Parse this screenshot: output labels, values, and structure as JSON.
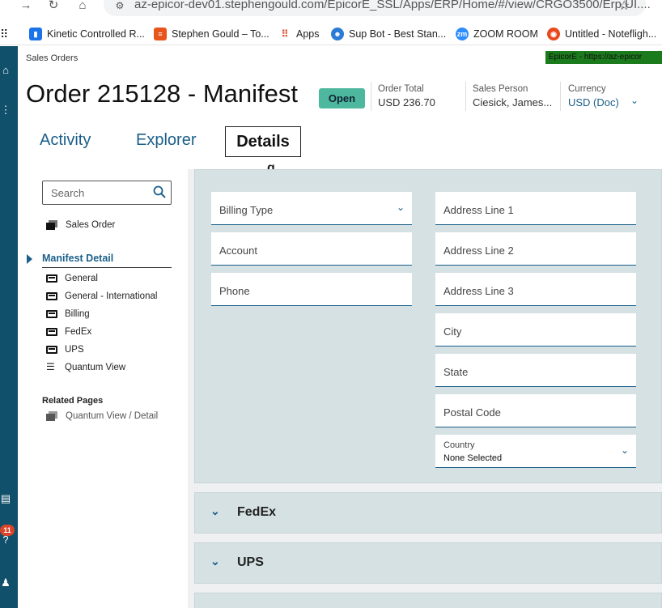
{
  "browser": {
    "url": "az-epicor-dev01.stephengould.com/EpicorE_SSL/Apps/ERP/Home/#/view/CRGO3500/Erp.UI....",
    "bookmarks": [
      {
        "label": "Kinetic Controlled R...",
        "icon": "bookmark-icon",
        "color": "#1a73e8"
      },
      {
        "label": "Stephen Gould – To...",
        "icon": "stack-icon",
        "color": "#e8551c"
      },
      {
        "label": "Apps",
        "icon": "apps-grid-icon",
        "color": "#e04d2f"
      },
      {
        "label": "Sup Bot - Best Stan...",
        "icon": "bot-icon",
        "color": "#2b7bd6"
      },
      {
        "label": "ZOOM ROOM",
        "icon": "zoom-icon",
        "color": "#2d8cff"
      },
      {
        "label": "Untitled - Notefligh...",
        "icon": "noteflight-icon",
        "color": "#e8491d"
      }
    ]
  },
  "app": {
    "breadcrumb": "Sales Orders",
    "environment_tag": "EpicorE  -  https://az-epicor",
    "notification_count": "11"
  },
  "header": {
    "title": "Order 215128 - Manifest",
    "status": "Open",
    "order_total_label": "Order Total",
    "order_total_value": "USD  236.70",
    "sales_person_label": "Sales Person",
    "sales_person_value": "Ciesick, James...",
    "currency_label": "Currency",
    "currency_value": "USD (Doc)"
  },
  "tabs": [
    {
      "label": "Activity",
      "active": false
    },
    {
      "label": "Explorer",
      "active": false
    },
    {
      "label": "Details",
      "active": true
    }
  ],
  "sidebar": {
    "search_placeholder": "Search",
    "sales_order": "Sales Order",
    "section": "Manifest Detail",
    "items": [
      "General",
      "General - International",
      "Billing",
      "FedEx",
      "UPS",
      "Quantum View"
    ],
    "related_heading": "Related Pages",
    "related_items": [
      "Quantum View / Detail"
    ]
  },
  "billing": {
    "left_fields": [
      "Billing Type",
      "Account",
      "Phone"
    ],
    "right_fields": [
      "Address Line 1",
      "Address Line 2",
      "Address Line 3",
      "City",
      "State",
      "Postal Code"
    ],
    "country_label": "Country",
    "country_value": "None Selected"
  },
  "panels": [
    "FedEx",
    "UPS"
  ]
}
